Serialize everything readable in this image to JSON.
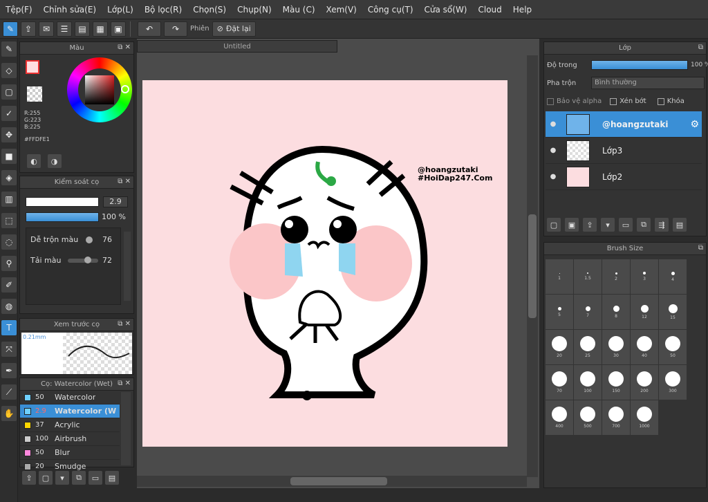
{
  "menu": [
    "Tệp(F)",
    "Chỉnh sửa(E)",
    "Lớp(L)",
    "Bộ lọc(R)",
    "Chọn(S)",
    "Chụp(N)",
    "Màu (C)",
    "Xem(V)",
    "Công cụ(T)",
    "Cửa sổ(W)",
    "Cloud",
    "Help"
  ],
  "toolbar": {
    "phien_label": "Phiên",
    "reset_label": "Đặt lại"
  },
  "document": {
    "title": "Untitled"
  },
  "color_panel": {
    "title": "Màu",
    "rgb_r": "R:255",
    "rgb_g": "G:223",
    "rgb_b": "B:225",
    "hex": "#FFDFE1",
    "primary_color": "#ffdfe1",
    "secondary_color": "#6fb3ea"
  },
  "brush_control": {
    "title": "Kiểm soát cọ",
    "size": "2.9",
    "opacity": "100 %",
    "blend_label": "Dễ trộn màu",
    "blend_value": "76",
    "load_label": "Tải màu",
    "load_value": "72"
  },
  "preview": {
    "title": "Xem trước cọ",
    "size_label": "0.21mm"
  },
  "brush_list": {
    "title": "Cọ: Watercolor (Wet)",
    "items": [
      {
        "size": "50",
        "name": "Watercolor",
        "color": "#6fd0ff"
      },
      {
        "size": "2.9",
        "name": "Watercolor (W",
        "color": "#6fd0ff",
        "selected": true
      },
      {
        "size": "37",
        "name": "Acrylic",
        "color": "#ffd700"
      },
      {
        "size": "100",
        "name": "Airbrush",
        "color": "#cccccc"
      },
      {
        "size": "50",
        "name": "Blur",
        "color": "#ff88dd"
      },
      {
        "size": "20",
        "name": "Smudge",
        "color": "#aaaaaa"
      }
    ]
  },
  "layer_panel": {
    "title": "Lớp",
    "opacity_label": "Độ trong",
    "opacity_value": "100 %",
    "blend_label": "Pha trộn",
    "blend_value": "Bình thường",
    "protect_alpha": "Bảo vệ alpha",
    "clip": "Xén bớt",
    "lock": "Khóa",
    "layers": [
      {
        "name": "@hoangzutaki",
        "selected": true
      },
      {
        "name": "Lớp3",
        "selected": false
      },
      {
        "name": "Lớp2",
        "selected": false
      }
    ]
  },
  "brush_size": {
    "title": "Brush Size",
    "sizes": [
      "1",
      "1.5",
      "2",
      "3",
      "4",
      "5",
      "7",
      "8",
      "12",
      "15",
      "20",
      "25",
      "30",
      "40",
      "50",
      "70",
      "100",
      "150",
      "200",
      "300",
      "400",
      "500",
      "700",
      "1000"
    ]
  },
  "watermark": {
    "line1": "@hoangzutaki",
    "line2": "#HoiDap247.Com"
  }
}
